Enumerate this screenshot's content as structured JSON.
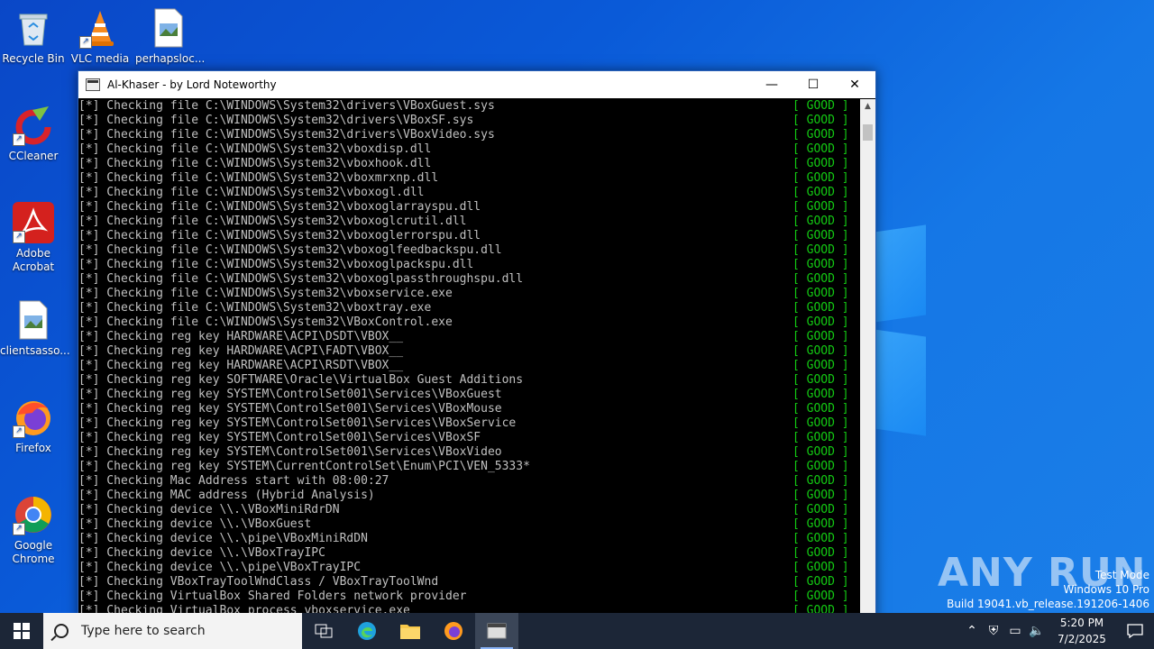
{
  "desktop": {
    "icons": [
      {
        "label": "Recycle Bin",
        "name": "recycle-bin"
      },
      {
        "label": "VLC media",
        "name": "vlc-media"
      },
      {
        "label": "perhapsloc...",
        "name": "perhapsloc-file"
      },
      {
        "label": "CCleaner",
        "name": "ccleaner"
      },
      {
        "label": "Adobe Acrobat",
        "name": "adobe-acrobat"
      },
      {
        "label": "clientsasso...",
        "name": "clientsasso-file"
      },
      {
        "label": "Firefox",
        "name": "firefox"
      },
      {
        "label": "Google Chrome",
        "name": "google-chrome"
      }
    ]
  },
  "window": {
    "title": "Al-Khaser - by Lord Noteworthy",
    "minimize_glyph": "—",
    "maximize_glyph": "☐",
    "close_glyph": "✕"
  },
  "console": {
    "status": "[ GOOD ]",
    "lines": [
      "[*] Checking file C:\\WINDOWS\\System32\\drivers\\VBoxGuest.sys",
      "[*] Checking file C:\\WINDOWS\\System32\\drivers\\VBoxSF.sys",
      "[*] Checking file C:\\WINDOWS\\System32\\drivers\\VBoxVideo.sys",
      "[*] Checking file C:\\WINDOWS\\System32\\vboxdisp.dll",
      "[*] Checking file C:\\WINDOWS\\System32\\vboxhook.dll",
      "[*] Checking file C:\\WINDOWS\\System32\\vboxmrxnp.dll",
      "[*] Checking file C:\\WINDOWS\\System32\\vboxogl.dll",
      "[*] Checking file C:\\WINDOWS\\System32\\vboxoglarrayspu.dll",
      "[*] Checking file C:\\WINDOWS\\System32\\vboxoglcrutil.dll",
      "[*] Checking file C:\\WINDOWS\\System32\\vboxoglerrorspu.dll",
      "[*] Checking file C:\\WINDOWS\\System32\\vboxoglfeedbackspu.dll",
      "[*] Checking file C:\\WINDOWS\\System32\\vboxoglpackspu.dll",
      "[*] Checking file C:\\WINDOWS\\System32\\vboxoglpassthroughspu.dll",
      "[*] Checking file C:\\WINDOWS\\System32\\vboxservice.exe",
      "[*] Checking file C:\\WINDOWS\\System32\\vboxtray.exe",
      "[*] Checking file C:\\WINDOWS\\System32\\VBoxControl.exe",
      "[*] Checking reg key HARDWARE\\ACPI\\DSDT\\VBOX__",
      "[*] Checking reg key HARDWARE\\ACPI\\FADT\\VBOX__",
      "[*] Checking reg key HARDWARE\\ACPI\\RSDT\\VBOX__",
      "[*] Checking reg key SOFTWARE\\Oracle\\VirtualBox Guest Additions",
      "[*] Checking reg key SYSTEM\\ControlSet001\\Services\\VBoxGuest",
      "[*] Checking reg key SYSTEM\\ControlSet001\\Services\\VBoxMouse",
      "[*] Checking reg key SYSTEM\\ControlSet001\\Services\\VBoxService",
      "[*] Checking reg key SYSTEM\\ControlSet001\\Services\\VBoxSF",
      "[*] Checking reg key SYSTEM\\ControlSet001\\Services\\VBoxVideo",
      "[*] Checking reg key SYSTEM\\CurrentControlSet\\Enum\\PCI\\VEN_5333*",
      "[*] Checking Mac Address start with 08:00:27",
      "[*] Checking MAC address (Hybrid Analysis)",
      "[*] Checking device \\\\.\\VBoxMiniRdrDN",
      "[*] Checking device \\\\.\\VBoxGuest",
      "[*] Checking device \\\\.\\pipe\\VBoxMiniRdDN",
      "[*] Checking device \\\\.\\VBoxTrayIPC",
      "[*] Checking device \\\\.\\pipe\\VBoxTrayIPC",
      "[*] Checking VBoxTrayToolWndClass / VBoxTrayToolWnd",
      "[*] Checking VirtualBox Shared Folders network provider",
      "[*] Checking VirtualBox process vboxservice.exe"
    ]
  },
  "watermark": {
    "logo": "ANY RUN",
    "line1": "Test Mode",
    "line2": "Windows 10 Pro",
    "line3": "Build 19041.vb_release.191206-1406"
  },
  "taskbar": {
    "search_placeholder": "Type here to search",
    "time": "5:20 PM",
    "date": "7/2/2025"
  }
}
